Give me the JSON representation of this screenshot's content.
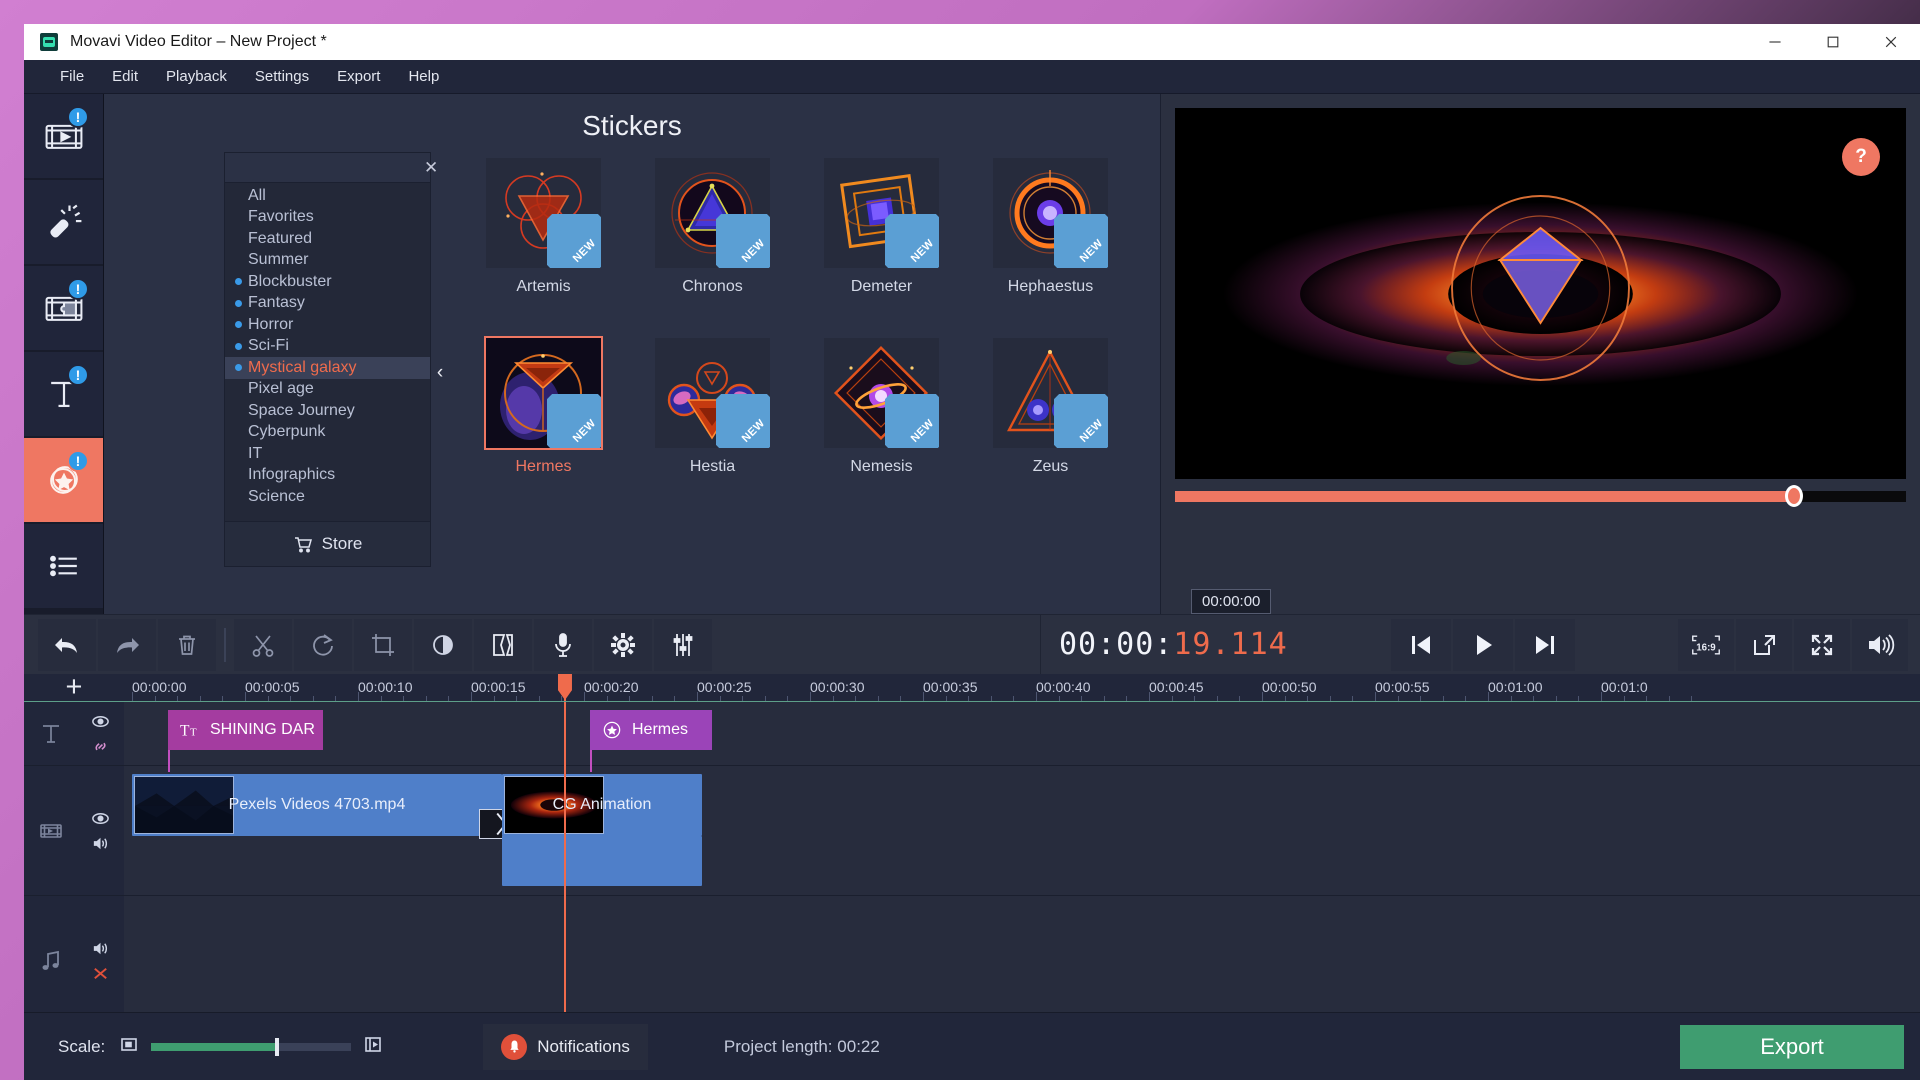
{
  "window": {
    "title": "Movavi Video Editor – New Project *",
    "minimize": "─",
    "maximize": "☐",
    "close": "✕"
  },
  "menu": [
    "File",
    "Edit",
    "Playback",
    "Settings",
    "Export",
    "Help"
  ],
  "rail": [
    {
      "name": "import-media",
      "badge": "!"
    },
    {
      "name": "filters",
      "badge": ""
    },
    {
      "name": "transitions",
      "badge": "!"
    },
    {
      "name": "titles",
      "badge": "!"
    },
    {
      "name": "stickers",
      "badge": "!",
      "active": true
    },
    {
      "name": "more-tools",
      "badge": ""
    }
  ],
  "browser": {
    "title": "Stickers",
    "search": {
      "value": "",
      "placeholder": ""
    },
    "clear_label": "✕",
    "collapse_label": "‹",
    "store_label": "Store",
    "categories": [
      {
        "label": "All",
        "dot": false
      },
      {
        "label": "Favorites",
        "dot": false
      },
      {
        "label": "Featured",
        "dot": false
      },
      {
        "label": "Summer",
        "dot": false
      },
      {
        "label": "Blockbuster",
        "dot": true
      },
      {
        "label": "Fantasy",
        "dot": true
      },
      {
        "label": "Horror",
        "dot": true
      },
      {
        "label": "Sci-Fi",
        "dot": true
      },
      {
        "label": "Mystical galaxy",
        "dot": true,
        "selected": true
      },
      {
        "label": "Pixel age",
        "dot": false
      },
      {
        "label": "Space Journey",
        "dot": false
      },
      {
        "label": "Cyberpunk",
        "dot": false
      },
      {
        "label": "IT",
        "dot": false
      },
      {
        "label": "Infographics",
        "dot": false
      },
      {
        "label": "Science",
        "dot": false
      }
    ],
    "new_badge": "NEW",
    "stickers": [
      {
        "label": "Artemis",
        "new": true,
        "selected": false
      },
      {
        "label": "Chronos",
        "new": true,
        "selected": false
      },
      {
        "label": "Demeter",
        "new": true,
        "selected": false
      },
      {
        "label": "Hephaestus",
        "new": true,
        "selected": false
      },
      {
        "label": "Hermes",
        "new": true,
        "selected": true
      },
      {
        "label": "Hestia",
        "new": true,
        "selected": false
      },
      {
        "label": "Nemesis",
        "new": true,
        "selected": false
      },
      {
        "label": "Zeus",
        "new": true,
        "selected": false
      }
    ]
  },
  "preview": {
    "help_label": "?",
    "progress_percent": 84.7
  },
  "toolbar": {
    "icons": [
      "undo",
      "redo",
      "delete",
      "split",
      "rotate",
      "crop",
      "color-adjust",
      "transition",
      "record-audio",
      "clip-properties",
      "audio-mixer"
    ]
  },
  "transport": {
    "timecode_prefix": "00:00:",
    "timecode_value": "19.114",
    "tooltip": "00:00:00",
    "buttons": [
      "prev-frame",
      "play",
      "next-frame"
    ],
    "aspect_ratio": "16:9",
    "right_buttons": [
      "detach-player",
      "fullscreen",
      "volume"
    ]
  },
  "timeline": {
    "add_label": "+",
    "ruler_ticks": [
      "00:00:00",
      "00:00:05",
      "00:00:10",
      "00:00:15",
      "00:00:20",
      "00:00:25",
      "00:00:30",
      "00:00:35",
      "00:00:40",
      "00:00:45",
      "00:00:50",
      "00:00:55",
      "00:01:00",
      "00:01:0"
    ],
    "playhead_time": "00:00:19.114",
    "tracks": [
      {
        "name": "title-track",
        "icons": [
          "eye",
          "link"
        ]
      },
      {
        "name": "video-track",
        "icons": [
          "eye",
          "speaker"
        ]
      },
      {
        "name": "audio-track",
        "icons": [
          "speaker",
          "mute-x"
        ]
      }
    ],
    "clips": {
      "title_clip": "SHINING DAR",
      "sticker_clip": "Hermes",
      "video_clip_1": "Pexels Videos 4703.mp4",
      "video_clip_2": "CG Animation"
    }
  },
  "status": {
    "scale_label": "Scale:",
    "scale_percent": 62,
    "notifications_label": "Notifications",
    "project_length_label": "Project length:",
    "project_length_value": "00:22",
    "export_label": "Export"
  },
  "colors": {
    "accent": "#ef7762",
    "export_green": "#3f9d70",
    "title_clip": "#a43ca0",
    "sticker_clip": "#9b44b8",
    "video_clip": "#4f7fc9",
    "badge_blue": "#2f9be8"
  }
}
